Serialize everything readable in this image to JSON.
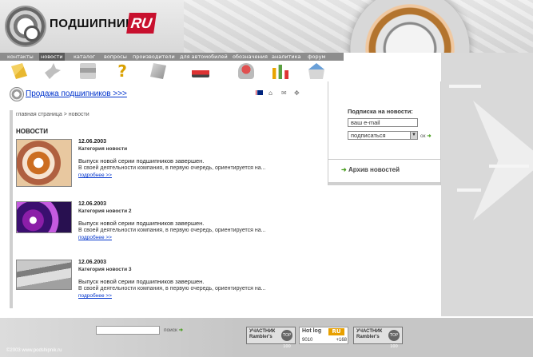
{
  "brand": {
    "logo_word": "ПОДШИПНИК",
    "logo_ru": "RU"
  },
  "topnav": {
    "items": [
      {
        "label": "контакты"
      },
      {
        "label": "новости"
      },
      {
        "label": "каталог"
      },
      {
        "label": "вопросы"
      },
      {
        "label": "производители"
      },
      {
        "label": "для автомобилей"
      },
      {
        "label": "обозначения"
      },
      {
        "label": "аналитика"
      },
      {
        "label": "форум"
      }
    ],
    "active_index": 1
  },
  "iconbar": {
    "icons": [
      "documents-icon",
      "bird-icon",
      "stack-icon",
      "question-icon",
      "box-icon",
      "car-icon",
      "bell-icon",
      "chart-icon",
      "house-icon"
    ]
  },
  "main": {
    "sell_link": "Продажа подшипников >>>",
    "breadcrumb": "главная страница > новости",
    "section_title": "НОВОСТИ",
    "news": [
      {
        "date": "12.06.2003",
        "category": "Категория новости",
        "headline": "Выпуск новой серии подшипников завершен.",
        "text": "В своей деятельности компания, в первую очередь, ориентируется на...",
        "more": "подробнее >>"
      },
      {
        "date": "12.06.2003",
        "category": "Категория новости 2",
        "headline": "Выпуск новой серии подшипников завершен.",
        "text": "В своей деятельности компания, в первую очередь, ориентируется на...",
        "more": "подробнее >>"
      },
      {
        "date": "12.06.2003",
        "category": "Категория новости 3",
        "headline": "Выпуск новой серии подшипников завершен.",
        "text": "В своей деятельности компания, в первую очередь, ориентируется на...",
        "more": "подробнее >>"
      }
    ]
  },
  "sidebar": {
    "subscribe_label": "Подписка на новости:",
    "email_value": "ваш e-mail",
    "select_value": "подписаться",
    "ok_label": "ок",
    "archive_label": "Архив новостей"
  },
  "footer": {
    "search_button": "поиск",
    "copyright": "©2003 www.podshipnik.ru",
    "rambler_line1": "УЧАСТНИК",
    "rambler_line2": "Rambler's",
    "rambler_top": "TOP 100",
    "hotlog_name": "Hot log",
    "hotlog_ru": "RU",
    "hotlog_left": "9010",
    "hotlog_right": "+168"
  },
  "colors": {
    "link": "#0033cc",
    "accent_green": "#4a9e20",
    "logo_red": "#c8102e",
    "nav_bg": "#8d8d8d"
  }
}
